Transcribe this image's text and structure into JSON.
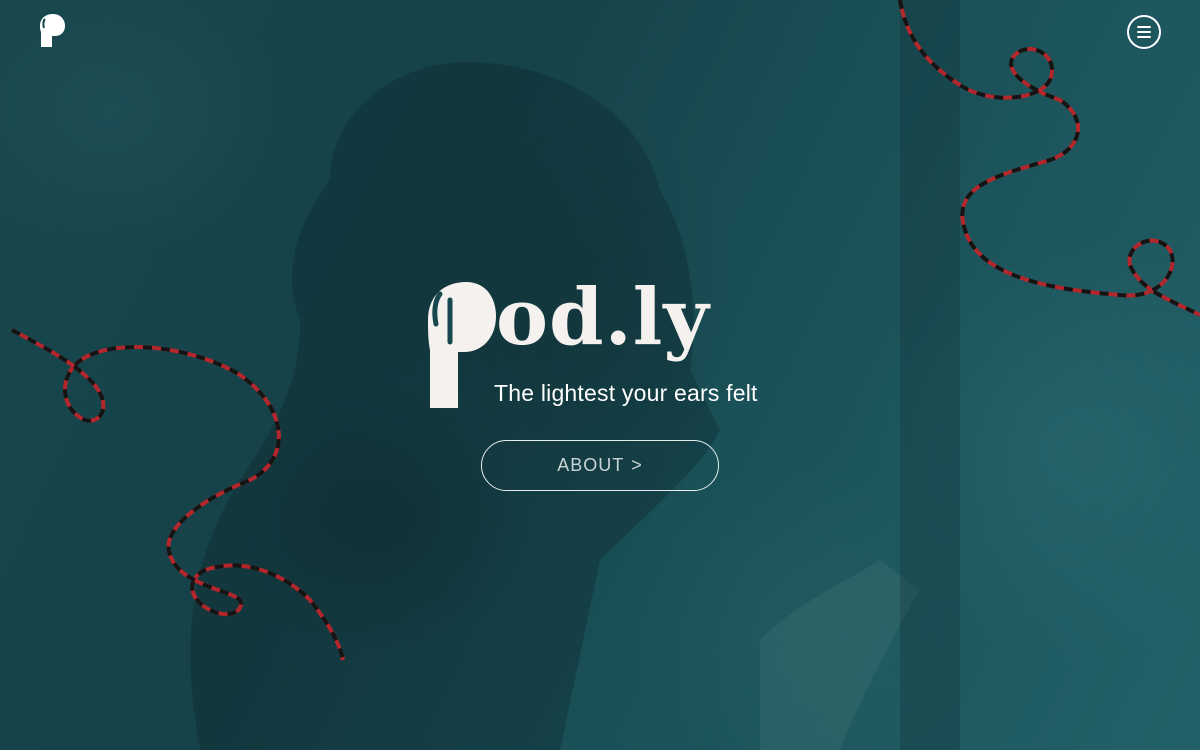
{
  "header": {
    "logo_icon": "p-logo-icon",
    "menu_icon": "hamburger-menu-icon"
  },
  "hero": {
    "brand_initial": "P",
    "brand_rest": "od.ly",
    "tagline": "The lightest your ears felt",
    "about_label": "ABOUT",
    "about_arrow": ">"
  },
  "colors": {
    "background": "#16484d",
    "brand_text": "#f4f1ee",
    "cord_red": "#b3262b",
    "cord_black": "#141414"
  }
}
